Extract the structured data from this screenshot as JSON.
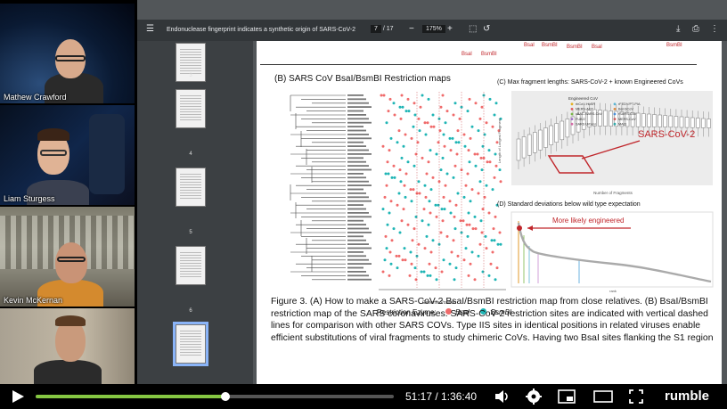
{
  "participants": [
    {
      "name": "Mathew Crawford"
    },
    {
      "name": "Liam Sturgess"
    },
    {
      "name": "Kevin McKernan"
    },
    {
      "name": ""
    }
  ],
  "pdf": {
    "title": "Endonuclease fingerprint indicates a synthetic origin of SARS-CoV-2",
    "page_current": "7",
    "page_total": "/ 17",
    "zoom": "175%",
    "thumbnails": [
      {
        "num": "3"
      },
      {
        "num": "4"
      },
      {
        "num": "5"
      },
      {
        "num": "6"
      },
      {
        "num": ""
      }
    ],
    "top_labels": [
      "Bsal",
      "BsmBI",
      "BsmBI",
      "Bsal",
      "BsmBI",
      "Bsal",
      "BsmBI"
    ],
    "panel_b_title": "(B) SARS CoV BsaI/BsmBI Restriction maps",
    "panel_b_xlabel": "Genome Position",
    "legend_label": "Restriction Ezyme:",
    "legend_bsai": "BsaI",
    "legend_bsmbi": "BsmBI",
    "panel_c_title": "(C) Max fragment lengths: SARS-CoV-2 + known Engineered CoVs",
    "panel_c_annotation": "SARS-CoV-2",
    "panel_c_xlabel": "Number of Fragments",
    "panel_c_ylabel": "Length of Longest Fragment",
    "panel_c_legend_title": "Engineered CoV",
    "panel_c_legend": [
      "rbCoV-HuSR",
      "MERS-ADT",
      "xBAC-SARS-CoV",
      "FUB/2",
      "SARS Urbani",
      "rFEDV/PT-PIA",
      "Bat-SCoV",
      "rSARS-CoV",
      "MERS-CoV",
      "MA11"
    ],
    "panel_d_title": "(D) Standard deviations below wild type expectation",
    "panel_d_annotation": "More likely engineered",
    "panel_d_xlabel": "rank",
    "caption": "Figure 3. (A) How to make a SARS-CoV-2 BsaI/BsmBI restriction map from close relatives. (B) BsaI/BsmBI restriction map of the SARS coronaviruses. SARS-CoV-2 restriction sites are indicated with vertical dashed lines for comparison with other SARS COVs. Type IIS sites in identical positions in related viruses enable efficient substitutions of viral fragments to study chimeric CoVs. Having two BsaI sites flanking the S1 region"
  },
  "player": {
    "time": "51:17 / 1:36:40",
    "progress": 0.53,
    "brand": "rumble"
  },
  "colors": {
    "bsai": "#f06b6b",
    "bsmbi": "#1fb5b5",
    "progress": "#85c742",
    "annotation": "#c0262b"
  }
}
